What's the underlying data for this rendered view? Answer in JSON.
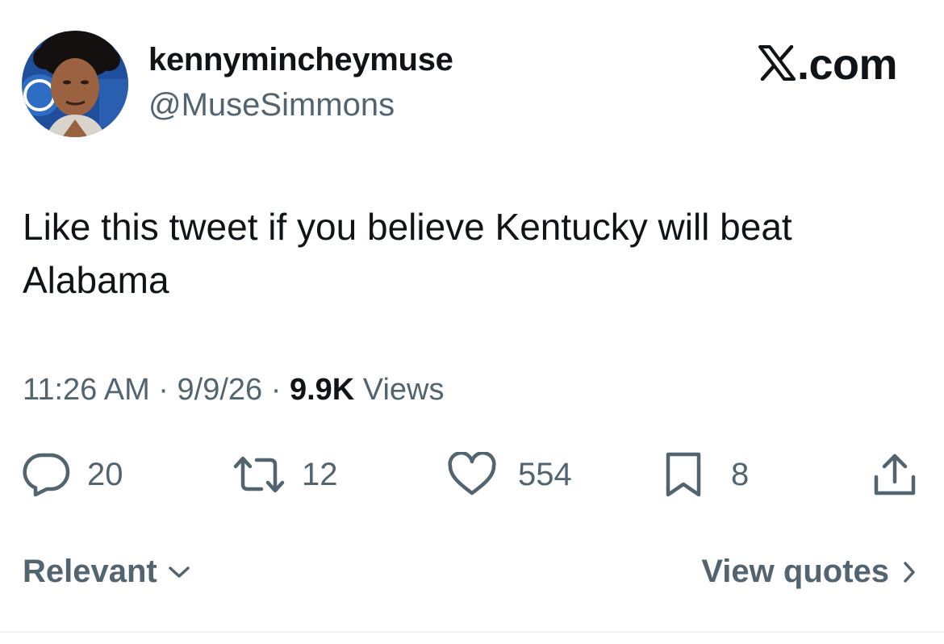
{
  "author": {
    "display_name": "kennymincheymuse",
    "handle": "@MuseSimmons"
  },
  "brand": {
    "label": ".com",
    "icon": "x-logo-icon"
  },
  "tweet": {
    "text": "Like this tweet if you believe Kentucky will beat Alabama"
  },
  "meta": {
    "time": "11:26 AM",
    "sep1": " · ",
    "date": "9/9/26",
    "sep2": " · ",
    "views_count": "9.9K",
    "views_label": " Views"
  },
  "actions": {
    "replies": {
      "icon": "reply-icon",
      "count": "20"
    },
    "reposts": {
      "icon": "repost-icon",
      "count": "12"
    },
    "likes": {
      "icon": "heart-icon",
      "count": "554"
    },
    "bookmarks": {
      "icon": "bookmark-icon",
      "count": "8"
    },
    "share": {
      "icon": "share-icon"
    }
  },
  "footer": {
    "sort_label": "Relevant",
    "quotes_label": "View quotes"
  },
  "colors": {
    "text_primary": "#0f1419",
    "text_secondary": "#536471",
    "divider": "#eff3f4"
  }
}
